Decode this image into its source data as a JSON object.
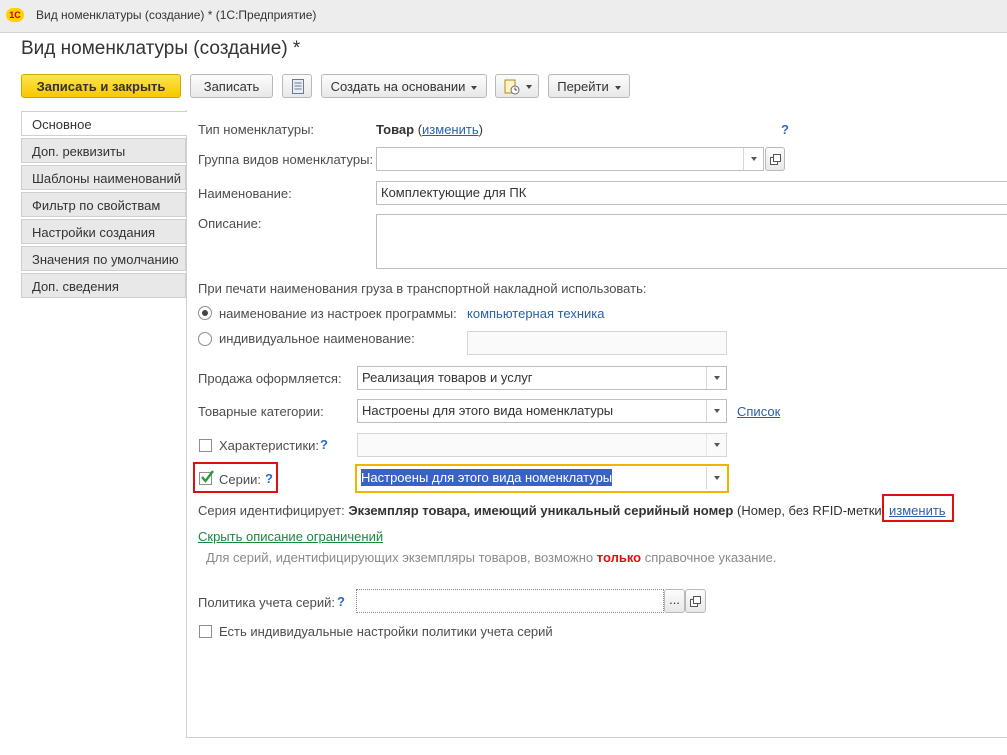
{
  "window": {
    "title": "Вид номенклатуры (создание) *  (1С:Предприятие)",
    "logo": "1С"
  },
  "form": {
    "title": "Вид номенклатуры (создание) *"
  },
  "toolbar": {
    "save_close": "Записать и закрыть",
    "save": "Записать",
    "create_based": "Создать на основании",
    "goto": "Перейти",
    "icons": [
      "list-icon",
      "report-icon"
    ]
  },
  "tabs": [
    "Основное",
    "Доп. реквизиты",
    "Шаблоны наименований",
    "Фильтр по свойствам",
    "Настройки создания",
    "Значения по умолчанию",
    "Доп. сведения"
  ],
  "main": {
    "type_label": "Тип номенклатуры:",
    "type_value": "Товар",
    "type_open": "(",
    "type_change": "изменить",
    "type_close": ")",
    "help": "?",
    "group_label": "Группа видов номенклатуры:",
    "group_value": "",
    "name_label": "Наименование:",
    "name_value": "Комплектующие для ПК",
    "desc_label": "Описание:",
    "desc_value": "",
    "print_label": "При печати наименования груза в транспортной накладной использовать:",
    "radio1_label": "наименование из настроек программы:",
    "radio1_value": "компьютерная техника",
    "radio2_label": "индивидуальное наименование:",
    "radio2_value": "",
    "sale_label": "Продажа оформляется:",
    "sale_value": "Реализация товаров и услуг",
    "categories_label": "Товарные категории:",
    "categories_value": "Настроены для этого вида номенклатуры",
    "categories_link": "Список",
    "characteristics_label": "Характеристики:",
    "characteristics_value": "",
    "series_label": "Серии:",
    "series_value": "Настроены для этого вида номенклатуры",
    "series_id_label": "Серия идентифицирует:",
    "series_id_value": "Экземпляр товара, имеющий уникальный серийный номер",
    "series_id_extra": "(Номер, без RFID-метки",
    "series_id_change": "изменить",
    "hide_desc_link": "Скрыть описание ограничений",
    "note_part1": "Для серий, идентифицирующих экземпляры товаров, возможно",
    "note_bold": "только",
    "note_part2": "справочное указание.",
    "policy_label": "Политика учета серий:",
    "policy_value": "",
    "policy_btn": "...",
    "individual_label": "Есть индивидуальные настройки политики учета серий"
  },
  "colors": {
    "accent_yellow": "#f5c800",
    "highlight_red": "#e01010",
    "selection_blue": "#3a62c4",
    "link_blue": "#2b5fa8",
    "green_link": "#1a8a3a",
    "emphasis_red": "#e01010",
    "focus_orange": "#f0b400"
  }
}
